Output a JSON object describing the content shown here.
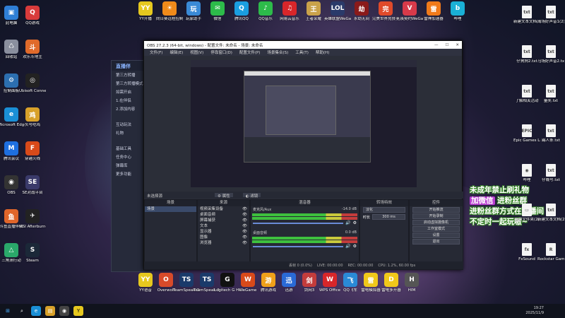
{
  "desktop_left": [
    {
      "label": "此电脑",
      "color": "#2f7fd6",
      "g": "▣"
    },
    {
      "label": "QQ游戏",
      "color": "#d83b3b",
      "g": "Q"
    },
    {
      "label": "回收站",
      "color": "#8a8f9e",
      "g": "♺"
    },
    {
      "label": "欢乐斗地主",
      "color": "#e06a2a",
      "g": "斗"
    },
    {
      "label": "控制面板",
      "color": "#2c6fb0",
      "g": "⚙"
    },
    {
      "label": "Ubisoft Connect",
      "color": "#222",
      "g": "◎"
    },
    {
      "label": "Microsoft Edge",
      "color": "#1a8fd6",
      "g": "e"
    },
    {
      "label": "头号吃鸡",
      "color": "#d8a12a",
      "g": "鸡"
    },
    {
      "label": "腾讯会议",
      "color": "#1e6fe0",
      "g": "M"
    },
    {
      "label": "穿越火线",
      "color": "#d84a1a",
      "g": "F"
    },
    {
      "label": "OBS",
      "color": "#333",
      "g": "◉"
    },
    {
      "label": "SE对战平台",
      "color": "#3a3a6a",
      "g": "SE"
    },
    {
      "label": "斗鱼直播伴侣",
      "color": "#e0662a",
      "g": "鱼"
    },
    {
      "label": "MSI Afterburner",
      "color": "#222",
      "g": "✈"
    },
    {
      "label": "三角洲行动",
      "color": "#2aa86a",
      "g": "△"
    },
    {
      "label": "Steam",
      "color": "#1b2838",
      "g": "S"
    }
  ],
  "desktop_top": [
    {
      "label": "YY开播",
      "color": "#e6c81e",
      "g": "YY"
    },
    {
      "label": "向日葵远程控制",
      "color": "#f08a1a",
      "g": "☀"
    },
    {
      "label": "玩家助手",
      "color": "#3a8ad6",
      "g": "玩"
    },
    {
      "label": "微信",
      "color": "#2dbb4a",
      "g": "✉"
    },
    {
      "label": "腾讯QQ",
      "color": "#1a9ee0",
      "g": "Q"
    },
    {
      "label": "QQ音乐",
      "color": "#2dbb4a",
      "g": "♪"
    },
    {
      "label": "网易云音乐",
      "color": "#d8262a",
      "g": "♫"
    },
    {
      "label": "王者荣耀",
      "color": "#c9a24a",
      "g": "王"
    },
    {
      "label": "英雄联盟WeGame版",
      "color": "#2a3a6a",
      "g": "LOL"
    },
    {
      "label": "永劫无间",
      "color": "#8a1a1a",
      "g": "劫"
    },
    {
      "label": "完美世界竞技平台",
      "color": "#e04a2a",
      "g": "完"
    },
    {
      "label": "无畏契约WeGame版",
      "color": "#d83a4a",
      "g": "V"
    },
    {
      "label": "雷神加速器",
      "color": "#f07a1a",
      "g": "雷"
    },
    {
      "label": "哔哩",
      "color": "#1ab0d6",
      "g": "b"
    }
  ],
  "desktop_right": [
    {
      "label": "新建文本文档(4).txt",
      "g": "txt"
    },
    {
      "label": "马场好声音1(2).txt",
      "g": "txt"
    },
    {
      "label": "仔狗狗2.txt",
      "g": "txt"
    },
    {
      "label": "马场好声音2.txt",
      "g": "txt"
    },
    {
      "label": "了解相关活动",
      "g": "txt"
    },
    {
      "label": "量奖.txt",
      "g": "txt"
    },
    {
      "label": "Epic Games Launcher",
      "g": "EPIC"
    },
    {
      "label": "踢人条.txt",
      "g": "txt"
    },
    {
      "label": "哔哩",
      "g": "◉"
    },
    {
      "label": "仔晚号.txt",
      "g": "txt"
    },
    {
      "label": "新建文件夹(2)",
      "g": "▭"
    },
    {
      "label": "新建文本文档(2)",
      "g": "txt"
    },
    {
      "label": "FxSound",
      "g": "fx"
    },
    {
      "label": "Rockstar Games",
      "g": "R"
    }
  ],
  "desktop_bottom": [
    {
      "label": "YY语音",
      "color": "#e6c81e",
      "g": "YY"
    },
    {
      "label": "Overwolf",
      "color": "#d84a2a",
      "g": "O"
    },
    {
      "label": "TeamSpeak Overlay",
      "color": "#1a3a6a",
      "g": "TS"
    },
    {
      "label": "TeamSpeak 3 Client",
      "color": "#1a3a6a",
      "g": "TS"
    },
    {
      "label": "Logitech G HUB",
      "color": "#111",
      "g": "G"
    },
    {
      "label": "WeGame",
      "color": "#d84a1a",
      "g": "W"
    },
    {
      "label": "腾讯游戏",
      "color": "#f0a01a",
      "g": "游"
    },
    {
      "label": "迅游",
      "color": "#2a6ad6",
      "g": "迅"
    },
    {
      "label": "剑网3",
      "color": "#c33c3c",
      "g": "剑"
    },
    {
      "label": "WPS Office",
      "color": "#d8262a",
      "g": "W"
    },
    {
      "label": "QQ飞车",
      "color": "#2a8ad6",
      "g": "飞"
    },
    {
      "label": "雷电模拟器",
      "color": "#f0c81a",
      "g": "雷"
    },
    {
      "label": "雷电多开器",
      "color": "#f0c81a",
      "g": "D"
    },
    {
      "label": "HIM",
      "color": "#555",
      "g": "H"
    }
  ],
  "live_helper": {
    "title": "直播伴",
    "rows": [
      "第三方转播",
      "第三方转播模式",
      "如需开启",
      "1.在伴侣",
      "2.添加内容",
      "互动玩法",
      "礼物",
      "基础工具",
      "任务中心",
      "弹幕库",
      "更多功能"
    ]
  },
  "obs": {
    "title": "OBS 27.2.3 (64-bit, windows) - 配置文件: 未命名 - 场景: 未命名",
    "menu": [
      "文件(F)",
      "编辑(E)",
      "视图(V)",
      "停靠窗口(D)",
      "配置文件(P)",
      "场景集合(S)",
      "工具(T)",
      "帮助(H)"
    ],
    "source_selected": "未选择源",
    "props_btn": "属性",
    "filters_btn": "滤镜",
    "docks": {
      "scenes": {
        "title": "场景",
        "items": [
          "场景"
        ]
      },
      "sources": {
        "title": "来源",
        "items": [
          "视频采集设备",
          "桌面音频",
          "屏幕捕获",
          "文本",
          "显示器",
          "图像",
          "浏览器"
        ]
      },
      "mixer": {
        "title": "混音器",
        "channels": [
          {
            "name": "麦克风/Aux",
            "db": "-14.0 dB"
          },
          {
            "name": "桌面音频",
            "db": "0.0 dB"
          }
        ]
      },
      "transitions": {
        "title": "转场特效",
        "type": "淡化",
        "duration_label": "时长",
        "duration": "300 ms"
      },
      "controls": {
        "title": "控件",
        "buttons": [
          "开始推流",
          "开始录制",
          "启动虚拟摄像机",
          "工作室模式",
          "设置",
          "退出"
        ]
      }
    },
    "status": [
      "丢帧 0 (0.0%)",
      "LIVE: 00:00:00",
      "REC: 00:00:00",
      "CPU: 1.2%, 60.00 fps"
    ]
  },
  "promo_lines": [
    "未成年禁止刷礼物",
    "进粉丝群",
    "进粉丝群方式在直播间",
    "不定时一起玩嗷~"
  ],
  "promo_tag": "加微信",
  "clock": {
    "time": "19:27",
    "date": "2025/11/9"
  }
}
